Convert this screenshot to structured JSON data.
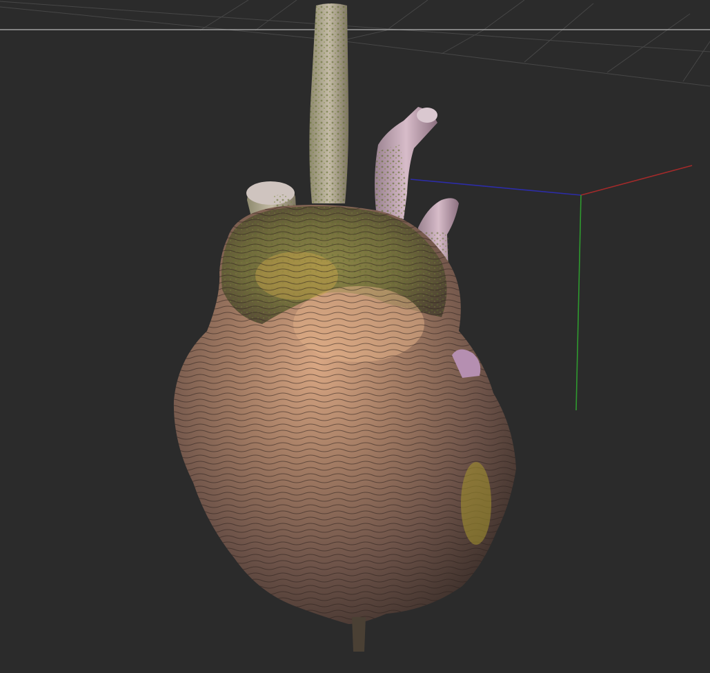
{
  "viewport": {
    "background_color": "#2b2b2b",
    "grid_color": "#4a4a4a",
    "horizon_color": "#b8b8b8"
  },
  "axes": {
    "x_color": "#a32a2a",
    "y_color": "#2f9a2f",
    "z_color": "#2c2ca8"
  },
  "model": {
    "kind": "textured heart mesh",
    "palette": {
      "body_light": "#c99a7a",
      "body_mid": "#8a6a58",
      "body_dark": "#4a3a32",
      "moss": "#7f8a3a",
      "vessel": "#b9ad9c",
      "vessel_pink": "#c9a6b8"
    }
  }
}
